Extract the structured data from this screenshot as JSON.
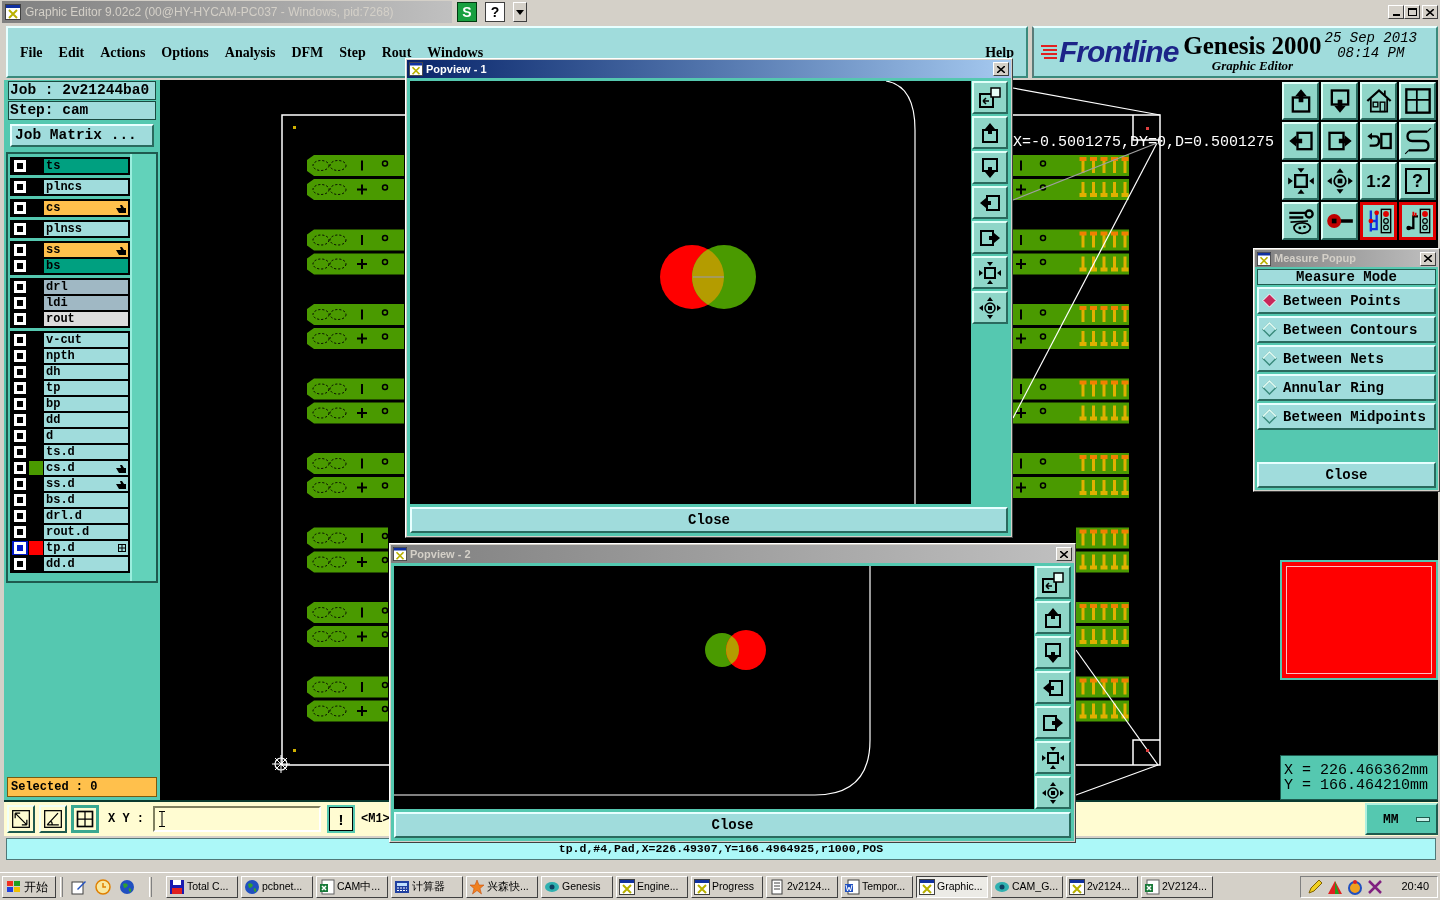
{
  "window": {
    "title": "Graphic Editor 9.02c2 (00@HY-HYCAM-PC037 - Windows, pid:7268)",
    "active": false,
    "title_buttons": [
      {
        "label": "S",
        "kind": "script"
      },
      {
        "label": "?",
        "kind": "help"
      }
    ]
  },
  "menu": {
    "items": [
      "File",
      "Edit",
      "Actions",
      "Options",
      "Analysis",
      "DFM",
      "Step",
      "Rout",
      "Windows"
    ],
    "help": "Help"
  },
  "branding": {
    "logo": "Frontline",
    "product": "Genesis 2000",
    "subtitle": "Graphic Editor",
    "date": "25 Sep 2013",
    "time": "08:14 PM"
  },
  "job_panel": {
    "job": "Job : 2v21244ba0",
    "step": "Step: cam",
    "job_matrix_button": "Job Matrix ...",
    "selected_count": "Selected : 0"
  },
  "layer_groups": [
    [
      {
        "name": "ts",
        "color": "#00a080",
        "checked": false,
        "selected": false,
        "affected": false
      }
    ],
    [
      {
        "name": "plncs",
        "color": "#a0dcdc",
        "checked": false,
        "selected": false,
        "affected": false
      }
    ],
    [
      {
        "name": "cs",
        "color": "#ffc04c",
        "checked": false,
        "selected": false,
        "affected": true
      }
    ],
    [
      {
        "name": "plnss",
        "color": "#a0dcdc",
        "checked": false,
        "selected": false,
        "affected": false
      }
    ],
    [
      {
        "name": "ss",
        "color": "#ffc04c",
        "checked": false,
        "selected": false,
        "affected": true
      },
      {
        "name": "bs",
        "color": "#00a080",
        "checked": false,
        "selected": false,
        "affected": false
      }
    ],
    [
      {
        "name": "drl",
        "color": "#a0b8c4",
        "checked": false,
        "selected": false,
        "affected": false
      },
      {
        "name": "ldi",
        "color": "#a0b8c4",
        "checked": false,
        "selected": false,
        "affected": false
      },
      {
        "name": "rout",
        "color": "#dcdcdc",
        "checked": false,
        "selected": false,
        "affected": false
      }
    ],
    [
      {
        "name": "v-cut",
        "color": "#a0dcdc",
        "checked": false,
        "selected": false,
        "affected": false
      },
      {
        "name": "npth",
        "color": "#a0dcdc",
        "checked": false,
        "selected": false,
        "affected": false
      },
      {
        "name": "dh",
        "color": "#a0dcdc",
        "checked": false,
        "selected": false,
        "affected": false
      },
      {
        "name": "tp",
        "color": "#a0dcdc",
        "checked": false,
        "selected": false,
        "affected": false
      },
      {
        "name": "bp",
        "color": "#a0dcdc",
        "checked": false,
        "selected": false,
        "affected": false
      },
      {
        "name": "dd",
        "color": "#a0dcdc",
        "checked": false,
        "selected": false,
        "affected": false
      },
      {
        "name": "d",
        "color": "#a0dcdc",
        "checked": false,
        "selected": false,
        "affected": false
      },
      {
        "name": "ts.d",
        "color": "#a0dcdc",
        "checked": false,
        "selected": false,
        "affected": false
      },
      {
        "name": "cs.d",
        "color": "#a0dcdc",
        "checked": false,
        "selected": false,
        "affected": true,
        "swatch": {
          "color": "#4a9a00"
        }
      },
      {
        "name": "ss.d",
        "color": "#a0dcdc",
        "checked": false,
        "selected": false,
        "affected": true
      },
      {
        "name": "bs.d",
        "color": "#a0dcdc",
        "checked": false,
        "selected": false,
        "affected": false
      },
      {
        "name": "drl.d",
        "color": "#a0dcdc",
        "checked": false,
        "selected": false,
        "affected": false
      },
      {
        "name": "rout.d",
        "color": "#a0dcdc",
        "checked": false,
        "selected": false,
        "affected": false
      },
      {
        "name": "tp.d",
        "color": "#a0dcdc",
        "checked": false,
        "selected": true,
        "affected": false,
        "swatch": {
          "color": "#ff0000"
        }
      },
      {
        "name": "dd.d",
        "color": "#a0dcdc",
        "checked": false,
        "selected": false,
        "affected": false
      }
    ]
  ],
  "canvas": {
    "measure_readout": "X=-0.5001275,DY=0,D=0.5001275"
  },
  "toolbar": [
    {
      "kind": "up",
      "on": false
    },
    {
      "kind": "down",
      "on": false
    },
    {
      "kind": "home",
      "on": false
    },
    {
      "kind": "grid",
      "on": false
    },
    {
      "kind": "left",
      "on": false
    },
    {
      "kind": "right",
      "on": false
    },
    {
      "kind": "back",
      "on": false
    },
    {
      "kind": "snap",
      "on": false
    },
    {
      "kind": "fit",
      "on": false
    },
    {
      "kind": "center",
      "on": false
    },
    {
      "kind": "ratio",
      "label": "1:2",
      "on": false
    },
    {
      "kind": "help",
      "label": "?",
      "on": false
    },
    {
      "kind": "tools",
      "on": false
    },
    {
      "kind": "probe",
      "on": false
    },
    {
      "kind": "net",
      "on": true
    },
    {
      "kind": "net2",
      "on": true
    }
  ],
  "measure_popup": {
    "title": "Measure Popup",
    "active": false,
    "header": "Measure Mode",
    "options": [
      {
        "label": "Between Points",
        "selected": true
      },
      {
        "label": "Between Contours",
        "selected": false
      },
      {
        "label": "Between Nets",
        "selected": false
      },
      {
        "label": "Annular Ring",
        "selected": false
      },
      {
        "label": "Between Midpoints",
        "selected": false
      }
    ],
    "close_button": "Close"
  },
  "coordinates": {
    "x": "X = 226.466362mm",
    "y": "Y = 166.464210mm"
  },
  "command_bar": {
    "tools": [
      {
        "kind": "arrow",
        "on": false
      },
      {
        "kind": "angle",
        "on": false
      },
      {
        "kind": "grid",
        "on": true
      }
    ],
    "xy_label": "X Y :",
    "exec_button": "!",
    "mode": "<M1>",
    "units": "MM"
  },
  "status_line": "tp.d,#4,Pad,X=226.49307,Y=166.4964925,r1000,POS",
  "popviews": [
    {
      "title": "Popview - 1",
      "active": true,
      "close_button": "Close"
    },
    {
      "title": "Popview - 2",
      "active": false,
      "close_button": "Close"
    }
  ],
  "taskbar": {
    "start": "开始",
    "tasks": [
      {
        "label": "Total C...",
        "kind": "disk",
        "selected": false
      },
      {
        "label": "pcbnet...",
        "kind": "globe",
        "selected": false
      },
      {
        "label": "CAM中...",
        "kind": "sheet",
        "selected": false
      },
      {
        "label": "计算器",
        "kind": "calc",
        "selected": false
      },
      {
        "label": "兴森快...",
        "kind": "star",
        "selected": false
      },
      {
        "label": "Genesis",
        "kind": "eye",
        "selected": false
      },
      {
        "label": "Engine...",
        "kind": "xwin",
        "selected": false
      },
      {
        "label": "Progress",
        "kind": "xwin",
        "selected": false
      },
      {
        "label": "2v2124...",
        "kind": "note",
        "selected": false
      },
      {
        "label": "Tempor...",
        "kind": "doc",
        "selected": false
      },
      {
        "label": "Graphic...",
        "kind": "xwin",
        "selected": true
      },
      {
        "label": "CAM_G...",
        "kind": "eye",
        "selected": false
      },
      {
        "label": "2v2124...",
        "kind": "xwin",
        "selected": false
      },
      {
        "label": "2V2124...",
        "kind": "sheet",
        "selected": false
      }
    ],
    "clock": "20:40"
  }
}
